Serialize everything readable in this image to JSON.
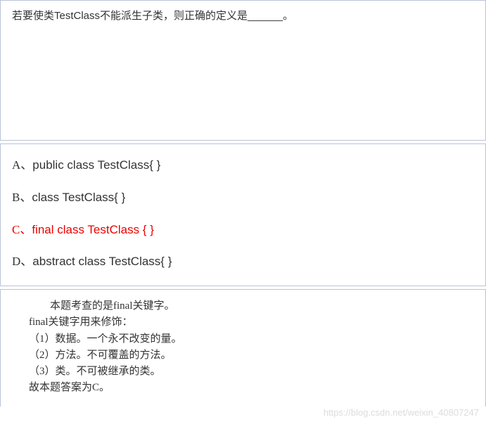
{
  "question": {
    "text": "若要使类TestClass不能派生子类，则正确的定义是______。"
  },
  "options": [
    {
      "label": "A、",
      "code": "public class TestClass{ }",
      "correct": false
    },
    {
      "label": "B、",
      "code": "class TestClass{ }",
      "correct": false
    },
    {
      "label": "C、",
      "code": "final class TestClass { }",
      "correct": true
    },
    {
      "label": "D、",
      "code": "abstract class TestClass{ }",
      "correct": false
    }
  ],
  "explanation": {
    "lines": [
      {
        "text": "本题考查的是final关键字。",
        "indent": true
      },
      {
        "text": "final关键字用来修饰：",
        "indent": false
      },
      {
        "text": "（1）数据。一个永不改变的量。",
        "indent": false
      },
      {
        "text": "（2）方法。不可覆盖的方法。",
        "indent": false
      },
      {
        "text": "（3）类。不可被继承的类。",
        "indent": false
      },
      {
        "text": "故本题答案为C。",
        "indent": false
      }
    ]
  },
  "watermark": "https://blog.csdn.net/weixin_40807247"
}
